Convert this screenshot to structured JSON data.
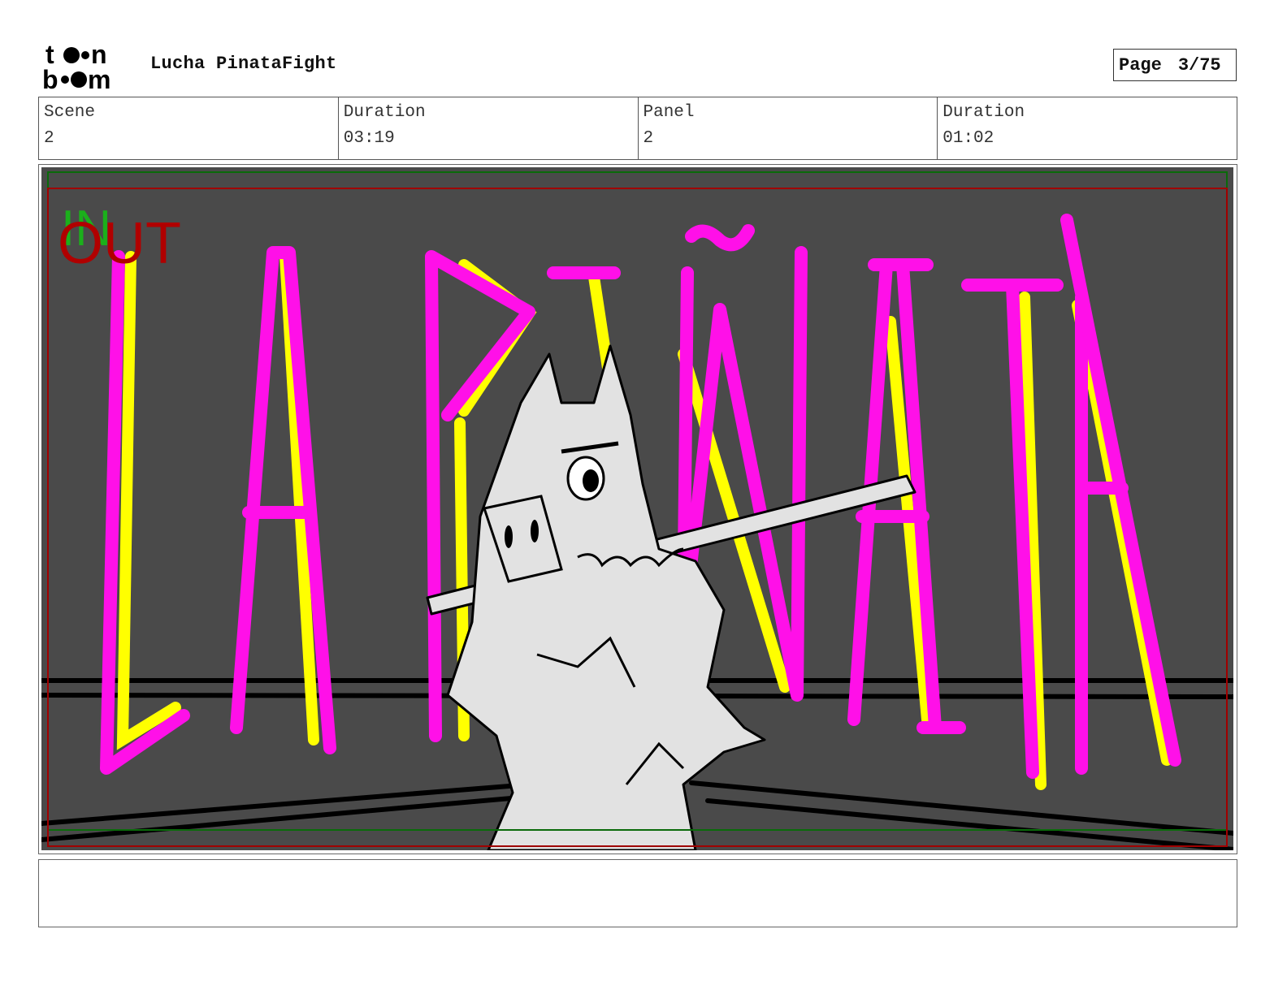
{
  "header": {
    "logo_text": "toonboom",
    "project_title": "Lucha PinataFight",
    "page_label": "Page",
    "page_value": "3/75"
  },
  "info": {
    "scene_label": "Scene",
    "scene_value": "2",
    "scene_duration_label": "Duration",
    "scene_duration_value": "03:19",
    "panel_label": "Panel",
    "panel_value": "2",
    "panel_duration_label": "Duration",
    "panel_duration_value": "01:02"
  },
  "panel": {
    "in_marker": "IN",
    "out_marker": "OUT",
    "colors": {
      "background": "#4a4a4a",
      "neon_magenta": "#ff10e8",
      "neon_yellow": "#ffff00",
      "in_marker": "#1bb01b",
      "out_marker": "#b00000",
      "character": "#e2e2e2"
    }
  },
  "notes": {
    "text": ""
  }
}
